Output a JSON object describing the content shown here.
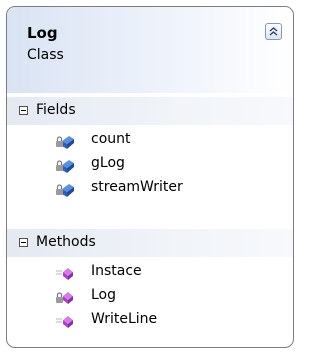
{
  "class_box": {
    "name": "Log",
    "kind": "Class"
  },
  "fields": {
    "label": "Fields",
    "items": [
      {
        "name": "count",
        "icon": "private-field-icon"
      },
      {
        "name": "gLog",
        "icon": "private-field-icon"
      },
      {
        "name": "streamWriter",
        "icon": "private-field-icon"
      }
    ]
  },
  "methods": {
    "label": "Methods",
    "items": [
      {
        "name": "Instace",
        "icon": "public-method-icon"
      },
      {
        "name": "Log",
        "icon": "private-method-icon"
      },
      {
        "name": "WriteLine",
        "icon": "public-method-icon"
      }
    ]
  },
  "colors": {
    "border": "#7d7d7d",
    "field_icon": "#3d6fc4",
    "method_icon": "#b04cc7"
  }
}
